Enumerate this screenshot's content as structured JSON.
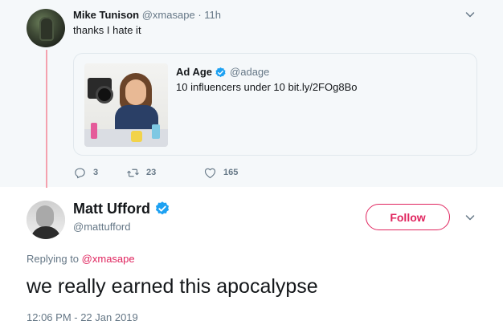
{
  "parent_tweet": {
    "name": "Mike Tunison",
    "handle": "@xmasape",
    "separator": "·",
    "time": "11h",
    "text": "thanks I hate it",
    "quoted": {
      "name": "Ad Age",
      "handle": "@adage",
      "text": "10 influencers under 10 bit.ly/2FOg8Bo"
    },
    "actions": {
      "replies": "3",
      "retweets": "23",
      "likes": "165"
    }
  },
  "main_tweet": {
    "name": "Matt Ufford",
    "handle": "@mattufford",
    "follow_label": "Follow",
    "replying_prefix": "Replying to",
    "replying_to": "@xmasape",
    "text": "we really earned this apocalypse",
    "timestamp": "12:06 PM - 22 Jan 2019"
  },
  "colors": {
    "accent": "#e0245e",
    "verified": "#1da1f2",
    "muted": "#657786",
    "thread_line": "#f4a1ae",
    "parent_bg": "#f5f8fa"
  },
  "icons": [
    "chevron-down-icon",
    "verified-badge-icon",
    "reply-icon",
    "retweet-icon",
    "like-icon"
  ]
}
